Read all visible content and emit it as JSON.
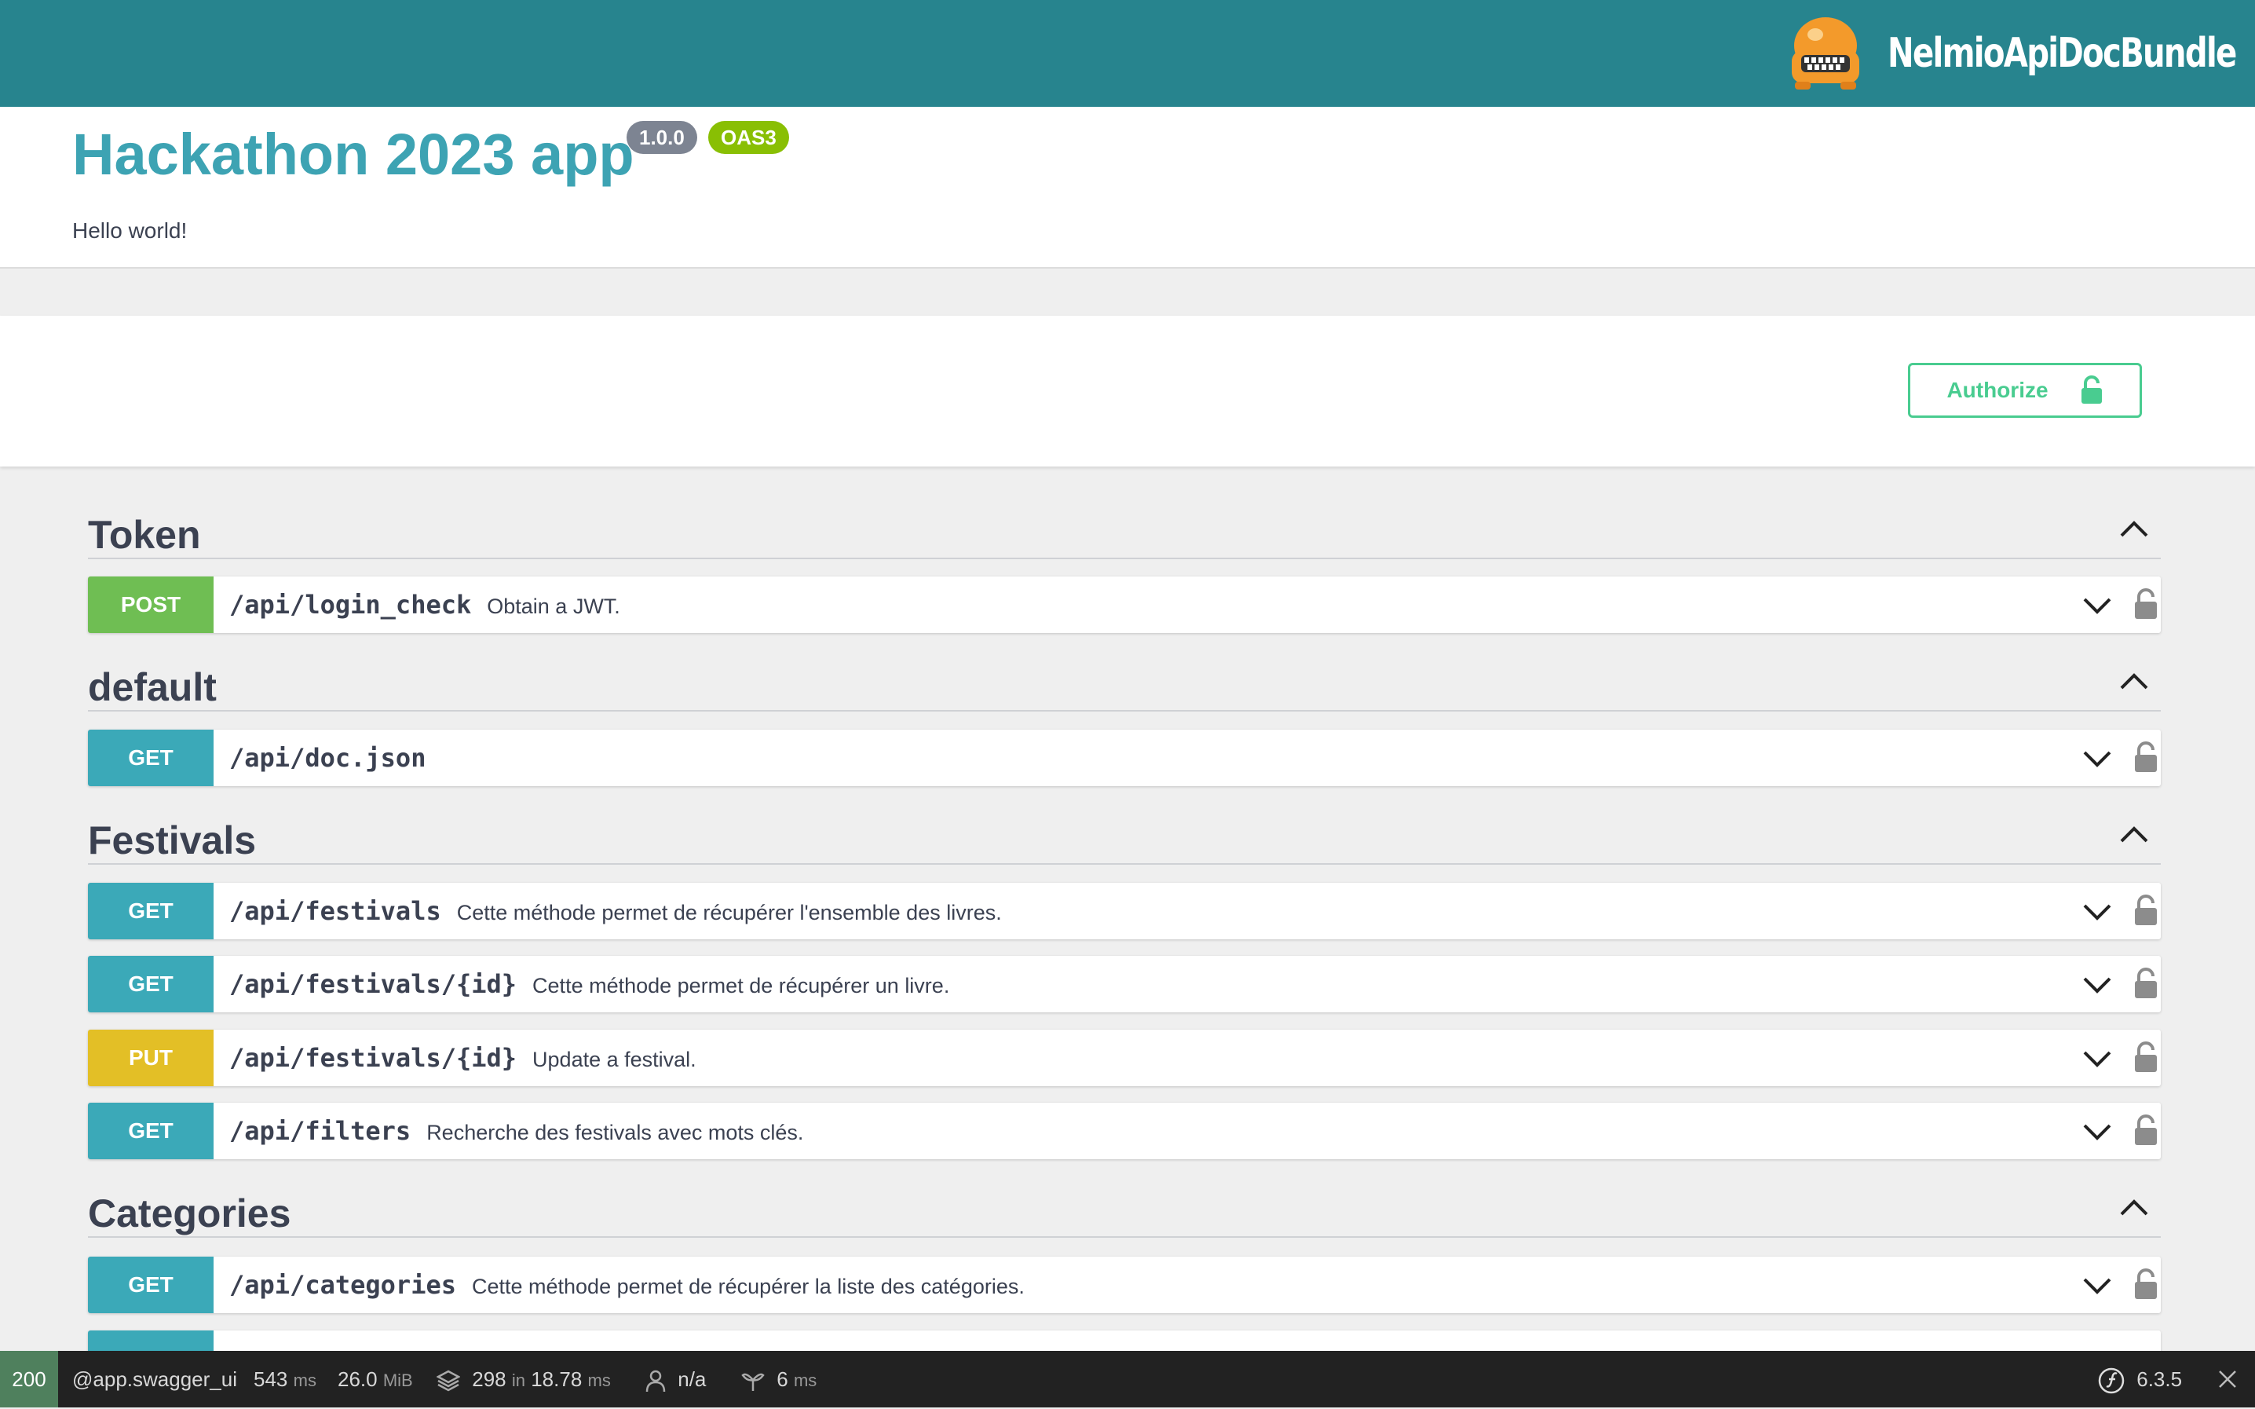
{
  "header": {
    "brand": "NelmioApiDocBundle",
    "logo_icon": "nelmio-robot-logo-icon",
    "bg_color": "#27848e"
  },
  "info": {
    "title": "Hackathon 2023 app",
    "version": "1.0.0",
    "oas": "OAS3",
    "description": "Hello world!"
  },
  "authorize": {
    "label": "Authorize",
    "icon": "unlocked-lock-icon",
    "color": "#49cc90"
  },
  "tags": [
    {
      "name": "Token"
    },
    {
      "name": "default"
    },
    {
      "name": "Festivals"
    },
    {
      "name": "Categories"
    }
  ],
  "operations": [
    {
      "method": "POST",
      "path": "/api/login_check",
      "summary": "Obtain a JWT."
    },
    {
      "method": "GET",
      "path": "/api/doc.json",
      "summary": ""
    },
    {
      "method": "GET",
      "path": "/api/festivals",
      "summary": "Cette méthode permet de récupérer l'ensemble des livres."
    },
    {
      "method": "GET",
      "path": "/api/festivals/{id}",
      "summary": "Cette méthode permet de récupérer un livre."
    },
    {
      "method": "PUT",
      "path": "/api/festivals/{id}",
      "summary": "Update a festival."
    },
    {
      "method": "GET",
      "path": "/api/filters",
      "summary": "Recherche des festivals avec mots clés."
    },
    {
      "method": "GET",
      "path": "/api/categories",
      "summary": "Cette méthode permet de récupérer la liste des catégories."
    }
  ],
  "method_colors": {
    "GET": "#3ba9b8",
    "POST": "#6fbe53",
    "PUT": "#e3bf26"
  },
  "toolbar": {
    "status": "200",
    "route": "@app.swagger_ui",
    "time": "543",
    "time_unit": "ms",
    "memory": "26.0",
    "memory_unit": "MiB",
    "events": "298",
    "events_in": "in",
    "events_time": "18.78",
    "events_unit": "ms",
    "user": "n/a",
    "twig_time": "6",
    "twig_unit": "ms",
    "symfony_version": "6.3.5"
  }
}
